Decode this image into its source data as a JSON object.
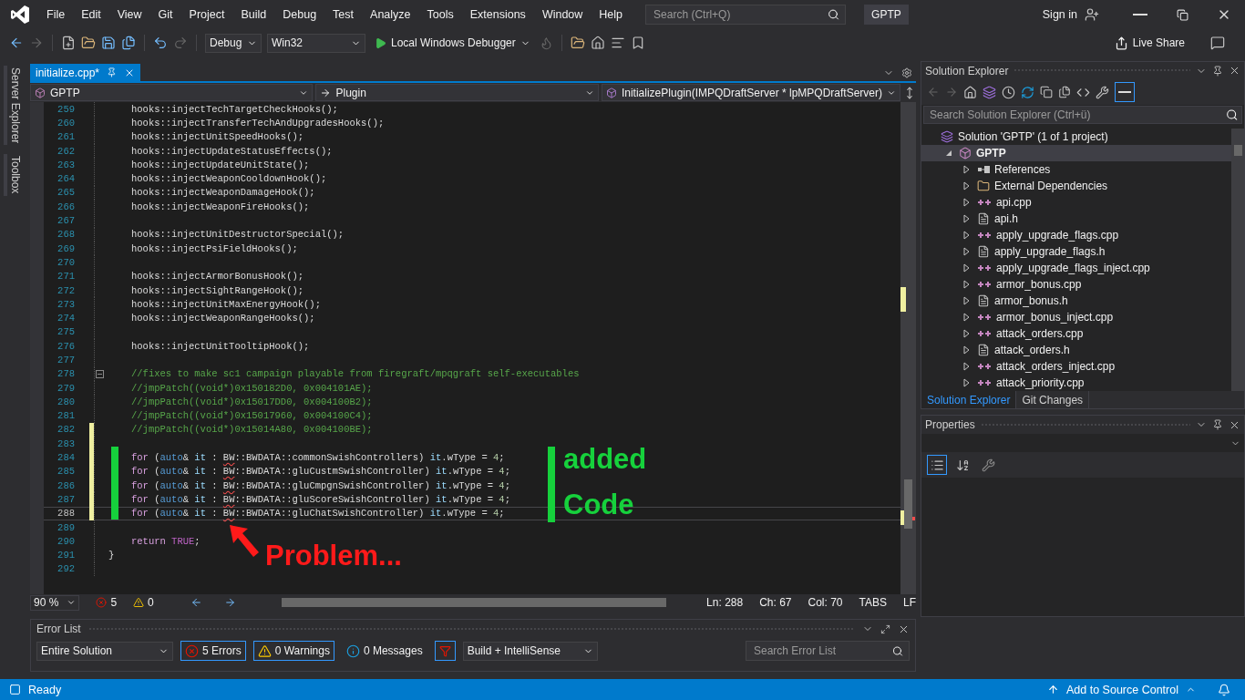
{
  "menu_bar": {
    "items": [
      "File",
      "Edit",
      "View",
      "Git",
      "Project",
      "Build",
      "Debug",
      "Test",
      "Analyze",
      "Tools",
      "Extensions",
      "Window",
      "Help"
    ],
    "search": {
      "placeholder": "Search (Ctrl+Q)"
    },
    "solution_badge": "GPTP",
    "sign_in": "Sign in"
  },
  "toolbar": {
    "configuration": "Debug",
    "platform": "Win32",
    "run_target": "Local Windows Debugger",
    "live_share": "Live Share"
  },
  "side_tabs": [
    "Server Explorer",
    "Toolbox"
  ],
  "editor": {
    "tabs": [
      {
        "label": "initialize.cpp*",
        "selected": true
      }
    ],
    "nav": {
      "project": "GPTP",
      "scope": "Plugin",
      "member": "InitializePlugin(IMPQDraftServer * lpMPQDraftServer)"
    },
    "lines": [
      {
        "no": "259",
        "indented": true,
        "modified": false,
        "current": false,
        "fold": false,
        "tokens": [
          {
            "t": "hooks::injectTechTargetCheckHooks();",
            "kind": "plain"
          }
        ]
      },
      {
        "no": "260",
        "indented": true,
        "modified": false,
        "current": false,
        "fold": false,
        "tokens": [
          {
            "t": "hooks::injectTransferTechAndUpgradesHooks();",
            "kind": "plain"
          }
        ]
      },
      {
        "no": "261",
        "indented": true,
        "modified": false,
        "current": false,
        "fold": false,
        "tokens": [
          {
            "t": "hooks::injectUnitSpeedHooks();",
            "kind": "plain"
          }
        ]
      },
      {
        "no": "262",
        "indented": true,
        "modified": false,
        "current": false,
        "fold": false,
        "tokens": [
          {
            "t": "hooks::injectUpdateStatusEffects();",
            "kind": "plain"
          }
        ]
      },
      {
        "no": "263",
        "indented": true,
        "modified": false,
        "current": false,
        "fold": false,
        "tokens": [
          {
            "t": "hooks::injectUpdateUnitState();",
            "kind": "plain"
          }
        ]
      },
      {
        "no": "264",
        "indented": true,
        "modified": false,
        "current": false,
        "fold": false,
        "tokens": [
          {
            "t": "hooks::injectWeaponCooldownHook();",
            "kind": "plain"
          }
        ]
      },
      {
        "no": "265",
        "indented": true,
        "modified": false,
        "current": false,
        "fold": false,
        "tokens": [
          {
            "t": "hooks::injectWeaponDamageHook();",
            "kind": "plain"
          }
        ]
      },
      {
        "no": "266",
        "indented": true,
        "modified": false,
        "current": false,
        "fold": false,
        "tokens": [
          {
            "t": "hooks::injectWeaponFireHooks();",
            "kind": "plain"
          }
        ]
      },
      {
        "no": "267",
        "modified": false,
        "current": false,
        "fold": false
      },
      {
        "no": "268",
        "indented": true,
        "modified": false,
        "current": false,
        "fold": false,
        "tokens": [
          {
            "t": "hooks::injectUnitDestructorSpecial();",
            "kind": "plain"
          }
        ]
      },
      {
        "no": "269",
        "indented": true,
        "modified": false,
        "current": false,
        "fold": false,
        "tokens": [
          {
            "t": "hooks::injectPsiFieldHooks();",
            "kind": "plain"
          }
        ]
      },
      {
        "no": "270",
        "modified": false,
        "current": false,
        "fold": false
      },
      {
        "no": "271",
        "indented": true,
        "modified": false,
        "current": false,
        "fold": false,
        "tokens": [
          {
            "t": "hooks::injectArmorBonusHook();",
            "kind": "plain"
          }
        ]
      },
      {
        "no": "272",
        "indented": true,
        "modified": false,
        "current": false,
        "fold": false,
        "tokens": [
          {
            "t": "hooks::injectSightRangeHook();",
            "kind": "plain"
          }
        ]
      },
      {
        "no": "273",
        "indented": true,
        "modified": false,
        "current": false,
        "fold": false,
        "tokens": [
          {
            "t": "hooks::injectUnitMaxEnergyHook();",
            "kind": "plain"
          }
        ]
      },
      {
        "no": "274",
        "indented": true,
        "modified": false,
        "current": false,
        "fold": false,
        "tokens": [
          {
            "t": "hooks::injectWeaponRangeHooks();",
            "kind": "plain"
          }
        ]
      },
      {
        "no": "275",
        "modified": false,
        "current": false,
        "fold": false
      },
      {
        "no": "276",
        "indented": true,
        "modified": false,
        "current": false,
        "fold": false,
        "tokens": [
          {
            "t": "hooks::injectUnitTooltipHook();",
            "kind": "plain"
          }
        ]
      },
      {
        "no": "277",
        "modified": false,
        "current": false,
        "fold": false
      },
      {
        "no": "278",
        "indented": true,
        "modified": false,
        "current": false,
        "fold": true,
        "tokens": [
          {
            "t": "//fixes to make sc1 campaign playable from firegraft/mpqgraft self-executables",
            "kind": "comment"
          }
        ]
      },
      {
        "no": "279",
        "indented": true,
        "modified": false,
        "current": false,
        "fold": false,
        "tokens": [
          {
            "t": "//jmpPatch((void*)0x150182D0, 0x004101AE);",
            "kind": "comment"
          }
        ]
      },
      {
        "no": "280",
        "indented": true,
        "modified": false,
        "current": false,
        "fold": false,
        "tokens": [
          {
            "t": "//jmpPatch((void*)0x15017DD0, 0x004100B2);",
            "kind": "comment"
          }
        ]
      },
      {
        "no": "281",
        "indented": true,
        "modified": false,
        "current": false,
        "fold": false,
        "tokens": [
          {
            "t": "//jmpPatch((void*)0x15017960, 0x004100C4);",
            "kind": "comment"
          }
        ]
      },
      {
        "no": "282",
        "indented": true,
        "modified": true,
        "current": false,
        "fold": false,
        "tokens": [
          {
            "t": "//jmpPatch((void*)0x15014A80, 0x004100BE);",
            "kind": "comment"
          }
        ]
      },
      {
        "no": "283",
        "modified": true,
        "current": false,
        "fold": false
      },
      {
        "no": "284",
        "indented": true,
        "modified": true,
        "current": false,
        "fold": false,
        "tokens": [
          {
            "t": "for",
            "kind": "control"
          },
          {
            "t": " (",
            "kind": "plain"
          },
          {
            "t": "auto",
            "kind": "keyword"
          },
          {
            "t": "& ",
            "kind": "plain"
          },
          {
            "t": "it",
            "kind": "variable"
          },
          {
            "t": " : ",
            "kind": "plain"
          },
          {
            "t": "BW",
            "kind": "error"
          },
          {
            "t": "::BWDATA::commonSwishControllers) ",
            "kind": "plain"
          },
          {
            "t": "it",
            "kind": "variable"
          },
          {
            "t": ".wType = ",
            "kind": "plain"
          },
          {
            "t": "4",
            "kind": "number"
          },
          {
            "t": ";",
            "kind": "plain"
          }
        ]
      },
      {
        "no": "285",
        "indented": true,
        "modified": true,
        "current": false,
        "fold": false,
        "tokens": [
          {
            "t": "for",
            "kind": "control"
          },
          {
            "t": " (",
            "kind": "plain"
          },
          {
            "t": "auto",
            "kind": "keyword"
          },
          {
            "t": "& ",
            "kind": "plain"
          },
          {
            "t": "it",
            "kind": "variable"
          },
          {
            "t": " : ",
            "kind": "plain"
          },
          {
            "t": "BW",
            "kind": "error"
          },
          {
            "t": "::BWDATA::gluCustmSwishController) ",
            "kind": "plain"
          },
          {
            "t": "it",
            "kind": "variable"
          },
          {
            "t": ".wType = ",
            "kind": "plain"
          },
          {
            "t": "4",
            "kind": "number"
          },
          {
            "t": ";",
            "kind": "plain"
          }
        ]
      },
      {
        "no": "286",
        "indented": true,
        "modified": true,
        "current": false,
        "fold": false,
        "tokens": [
          {
            "t": "for",
            "kind": "control"
          },
          {
            "t": " (",
            "kind": "plain"
          },
          {
            "t": "auto",
            "kind": "keyword"
          },
          {
            "t": "& ",
            "kind": "plain"
          },
          {
            "t": "it",
            "kind": "variable"
          },
          {
            "t": " : ",
            "kind": "plain"
          },
          {
            "t": "BW",
            "kind": "error"
          },
          {
            "t": "::BWDATA::gluCmpgnSwishController) ",
            "kind": "plain"
          },
          {
            "t": "it",
            "kind": "variable"
          },
          {
            "t": ".wType = ",
            "kind": "plain"
          },
          {
            "t": "4",
            "kind": "number"
          },
          {
            "t": ";",
            "kind": "plain"
          }
        ]
      },
      {
        "no": "287",
        "indented": true,
        "modified": true,
        "current": false,
        "fold": false,
        "tokens": [
          {
            "t": "for",
            "kind": "control"
          },
          {
            "t": " (",
            "kind": "plain"
          },
          {
            "t": "auto",
            "kind": "keyword"
          },
          {
            "t": "& ",
            "kind": "plain"
          },
          {
            "t": "it",
            "kind": "variable"
          },
          {
            "t": " : ",
            "kind": "plain"
          },
          {
            "t": "BW",
            "kind": "error"
          },
          {
            "t": "::BWDATA::gluScoreSwishController) ",
            "kind": "plain"
          },
          {
            "t": "it",
            "kind": "variable"
          },
          {
            "t": ".wType = ",
            "kind": "plain"
          },
          {
            "t": "4",
            "kind": "number"
          },
          {
            "t": ";",
            "kind": "plain"
          }
        ]
      },
      {
        "no": "288",
        "indented": true,
        "modified": true,
        "current": true,
        "fold": false,
        "tokens": [
          {
            "t": "for",
            "kind": "control"
          },
          {
            "t": " (",
            "kind": "plain"
          },
          {
            "t": "auto",
            "kind": "keyword"
          },
          {
            "t": "& ",
            "kind": "plain"
          },
          {
            "t": "it",
            "kind": "variable"
          },
          {
            "t": " : ",
            "kind": "plain"
          },
          {
            "t": "BW",
            "kind": "error"
          },
          {
            "t": "::BWDATA::gluChatSwishController) ",
            "kind": "plain"
          },
          {
            "t": "it",
            "kind": "variable"
          },
          {
            "t": ".wType = ",
            "kind": "plain"
          },
          {
            "t": "4",
            "kind": "number"
          },
          {
            "t": ";",
            "kind": "plain"
          }
        ]
      },
      {
        "no": "289",
        "modified": false,
        "current": false,
        "fold": false
      },
      {
        "no": "290",
        "indented": true,
        "modified": false,
        "current": false,
        "fold": false,
        "tokens": [
          {
            "t": "return",
            "kind": "control"
          },
          {
            "t": " TRUE",
            "kind": "macro"
          },
          {
            "t": ";",
            "kind": "plain"
          }
        ]
      },
      {
        "no": "291",
        "indented": false,
        "modified": false,
        "current": false,
        "fold": false,
        "tokens": [
          {
            "t": "}",
            "kind": "plain"
          }
        ]
      },
      {
        "no": "292",
        "modified": false,
        "current": false,
        "fold": false
      }
    ],
    "annotations": {
      "added": [
        "added",
        "Code"
      ],
      "problem": "Problem..."
    },
    "status": {
      "zoom": "90 %",
      "errors": "5",
      "warnings": "0",
      "ln": "Ln: 288",
      "ch": "Ch: 67",
      "col": "Col: 70",
      "indent": "TABS",
      "eol": "LF"
    }
  },
  "solution_explorer": {
    "title": "Solution Explorer",
    "search": {
      "placeholder": "Search Solution Explorer (Ctrl+ü)"
    },
    "preview_selected": true,
    "tree": [
      {
        "label": "Solution 'GPTP' (1 of 1 project)",
        "kind": "solution",
        "selected": false,
        "children": [
          {
            "label": "GPTP",
            "kind": "project",
            "expanded": true,
            "selected": true,
            "children": [
              {
                "label": "References",
                "kind": "references",
                "expanded": false,
                "selected": false
              },
              {
                "label": "External Dependencies",
                "kind": "folder",
                "expanded": false,
                "selected": false
              },
              {
                "label": "api.cpp",
                "kind": "cpp",
                "expanded": false,
                "selected": false
              },
              {
                "label": "api.h",
                "kind": "header",
                "expanded": false,
                "selected": false
              },
              {
                "label": "apply_upgrade_flags.cpp",
                "kind": "cpp",
                "expanded": false,
                "selected": false
              },
              {
                "label": "apply_upgrade_flags.h",
                "kind": "header",
                "expanded": false,
                "selected": false
              },
              {
                "label": "apply_upgrade_flags_inject.cpp",
                "kind": "cpp",
                "expanded": false,
                "selected": false
              },
              {
                "label": "armor_bonus.cpp",
                "kind": "cpp",
                "expanded": false,
                "selected": false
              },
              {
                "label": "armor_bonus.h",
                "kind": "header",
                "expanded": false,
                "selected": false
              },
              {
                "label": "armor_bonus_inject.cpp",
                "kind": "cpp",
                "expanded": false,
                "selected": false
              },
              {
                "label": "attack_orders.cpp",
                "kind": "cpp",
                "expanded": false,
                "selected": false
              },
              {
                "label": "attack_orders.h",
                "kind": "header",
                "expanded": false,
                "selected": false
              },
              {
                "label": "attack_orders_inject.cpp",
                "kind": "cpp",
                "expanded": false,
                "selected": false
              },
              {
                "label": "attack_priority.cpp",
                "kind": "cpp",
                "expanded": false,
                "selected": false
              }
            ]
          }
        ]
      }
    ],
    "tabs": [
      {
        "label": "Solution Explorer",
        "selected": true
      },
      {
        "label": "Git Changes",
        "selected": false
      }
    ]
  },
  "properties": {
    "title": "Properties",
    "buttons": [
      {
        "kind": "categorized",
        "selected": true
      },
      {
        "kind": "alphabetical",
        "selected": false
      },
      {
        "kind": "pages",
        "selected": false
      }
    ]
  },
  "error_list": {
    "title": "Error List",
    "scope": "Entire Solution",
    "filters": [
      {
        "label": "5 Errors",
        "kind": "error",
        "selected": true
      },
      {
        "label": "0 Warnings",
        "kind": "warning",
        "selected": true
      },
      {
        "label": "0 Messages",
        "kind": "message",
        "selected": false
      }
    ],
    "filter_active": true,
    "source": "Build + IntelliSense",
    "search": {
      "placeholder": "Search Error List"
    }
  },
  "status_bar": {
    "text": "Ready",
    "source_control": "Add to Source Control"
  }
}
